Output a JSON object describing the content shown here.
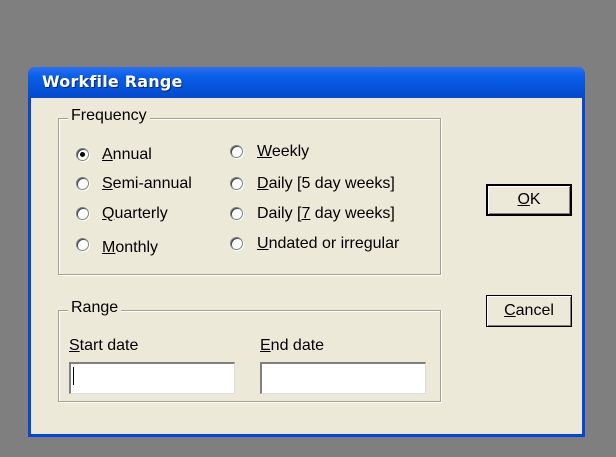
{
  "window": {
    "title": "Workfile Range"
  },
  "frequency": {
    "legend": "Frequency",
    "selected": "annual",
    "options": [
      {
        "id": "annual",
        "label": "Annual",
        "hotkey": "A",
        "rest": "nnual",
        "pre": ""
      },
      {
        "id": "semi-annual",
        "label": "Semi-annual",
        "hotkey": "S",
        "rest": "emi-annual",
        "pre": ""
      },
      {
        "id": "quarterly",
        "label": "Quarterly",
        "hotkey": "Q",
        "rest": "uarterly",
        "pre": ""
      },
      {
        "id": "monthly",
        "label": "Monthly",
        "hotkey": "M",
        "rest": "onthly",
        "pre": ""
      },
      {
        "id": "weekly",
        "label": "Weekly",
        "hotkey": "W",
        "rest": "eekly",
        "pre": ""
      },
      {
        "id": "daily-5",
        "label": "Daily [5 day weeks]",
        "hotkey": "D",
        "rest": "aily [5 day weeks]",
        "pre": ""
      },
      {
        "id": "daily-7",
        "label": "Daily [7 day weeks]",
        "hotkey": "7",
        "rest": " day weeks]",
        "pre": "Daily ["
      },
      {
        "id": "undated",
        "label": "Undated or irregular",
        "hotkey": "U",
        "rest": "ndated or irregular",
        "pre": ""
      }
    ]
  },
  "range": {
    "legend": "Range",
    "start_label_hot": "S",
    "start_label_rest": "tart date",
    "end_label_hot": "E",
    "end_label_rest": "nd date",
    "start_value": "",
    "end_value": ""
  },
  "buttons": {
    "ok_hot": "O",
    "ok_rest": "K",
    "cancel_hot": "C",
    "cancel_rest": "ancel"
  },
  "colors": {
    "titlebar": "#0552d9",
    "dialog_face": "#ece9d8",
    "desktop": "#7f7f7f"
  }
}
